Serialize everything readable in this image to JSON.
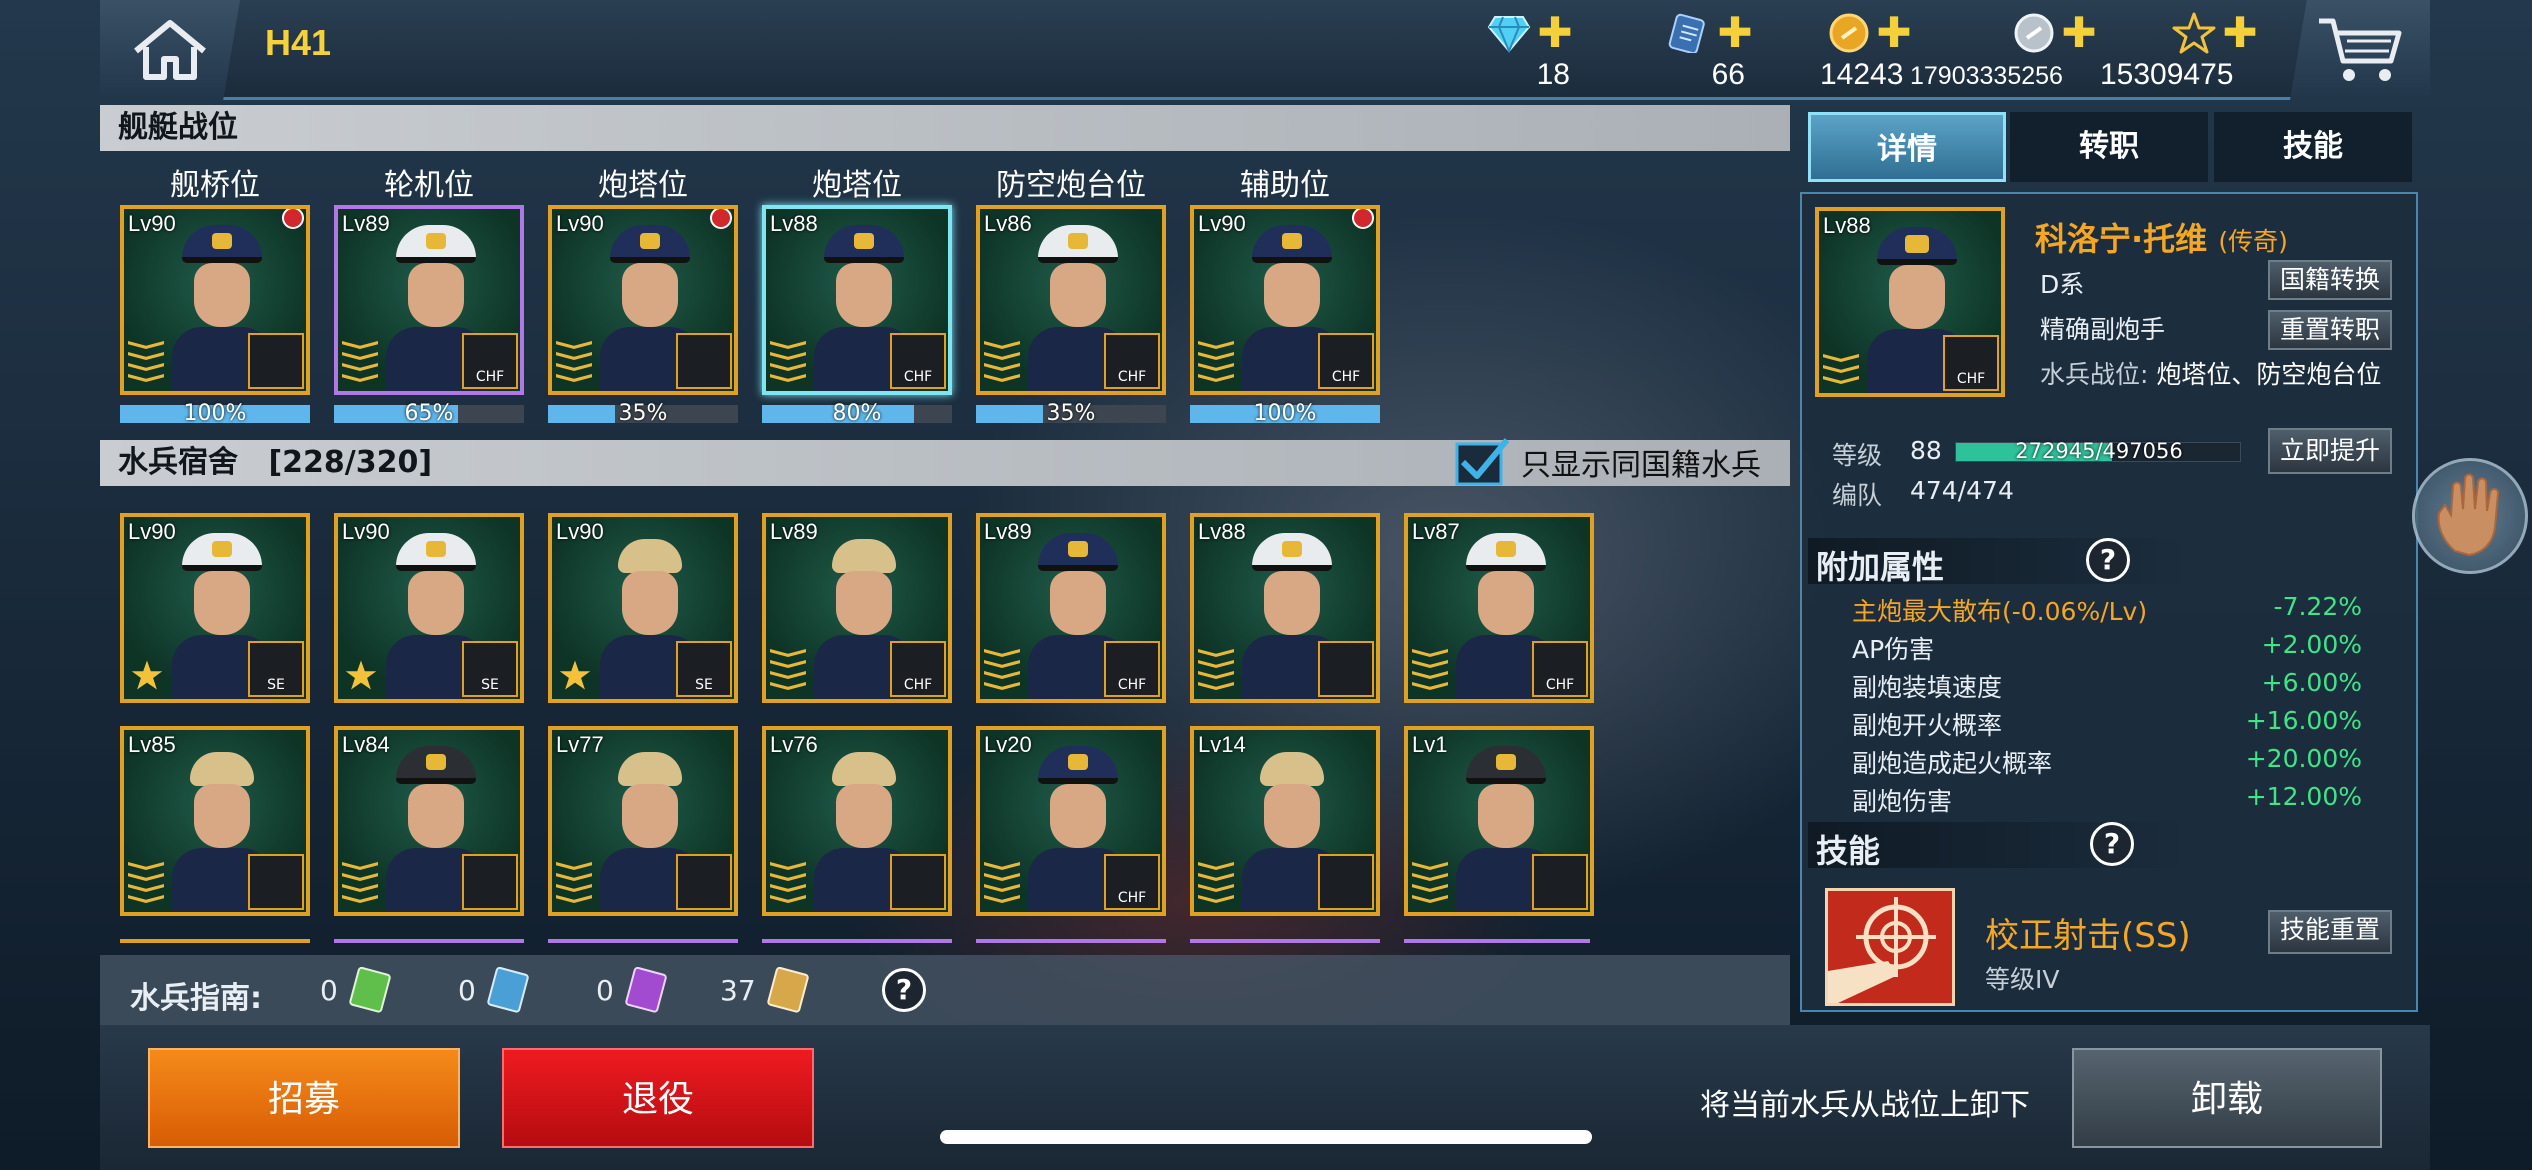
{
  "header": {
    "stage": "H41",
    "resources": [
      {
        "icon": "diamond-icon",
        "value": "18"
      },
      {
        "icon": "ticket-icon",
        "value": "66"
      },
      {
        "icon": "gold-coin-icon",
        "value": "14243"
      },
      {
        "icon": "silver-coin-icon",
        "value": "17903335256"
      },
      {
        "icon": "star-icon",
        "value": "15309475"
      }
    ]
  },
  "ship_positions": {
    "title": "舰艇战位",
    "slots": [
      {
        "label": "舰桥位",
        "lv": "Lv90",
        "percent": "100%",
        "fill": 1.0,
        "red_dot": true,
        "frame": "gold",
        "job_tag": "",
        "job_icon": "radio-icon"
      },
      {
        "label": "轮机位",
        "lv": "Lv89",
        "percent": "65%",
        "fill": 0.65,
        "red_dot": false,
        "frame": "purple",
        "job_tag": "CHF",
        "job_icon": "gear-icon"
      },
      {
        "label": "炮塔位",
        "lv": "Lv90",
        "percent": "35%",
        "fill": 0.35,
        "red_dot": true,
        "frame": "gold",
        "job_tag": "",
        "job_icon": "turret-icon"
      },
      {
        "label": "炮塔位",
        "lv": "Lv88",
        "percent": "80%",
        "fill": 0.8,
        "red_dot": false,
        "frame": "selected",
        "job_tag": "CHF",
        "job_icon": "turret-icon"
      },
      {
        "label": "防空炮台位",
        "lv": "Lv86",
        "percent": "35%",
        "fill": 0.35,
        "red_dot": false,
        "frame": "gold",
        "job_tag": "CHF",
        "job_icon": "aa-gun-icon"
      },
      {
        "label": "辅助位",
        "lv": "Lv90",
        "percent": "100%",
        "fill": 1.0,
        "red_dot": true,
        "frame": "gold",
        "job_tag": "CHF",
        "job_icon": "repair-icon"
      }
    ]
  },
  "barracks": {
    "title": "水兵宿舍",
    "count": "[228/320]",
    "filter_label": "只显示同国籍水兵",
    "filter_checked": true,
    "sailors": [
      {
        "lv": "Lv90",
        "tag": "SE",
        "star": true,
        "hat": "white"
      },
      {
        "lv": "Lv90",
        "tag": "SE",
        "star": true,
        "hat": "white"
      },
      {
        "lv": "Lv90",
        "tag": "SE",
        "star": true,
        "hat": "none"
      },
      {
        "lv": "Lv89",
        "tag": "CHF",
        "star": false,
        "hat": "none"
      },
      {
        "lv": "Lv89",
        "tag": "CHF",
        "star": false,
        "hat": "navy"
      },
      {
        "lv": "Lv88",
        "tag": "",
        "star": false,
        "hat": "white"
      },
      {
        "lv": "Lv87",
        "tag": "CHF",
        "star": false,
        "hat": "white"
      },
      {
        "lv": "Lv85",
        "tag": "",
        "star": false,
        "hat": "none"
      },
      {
        "lv": "Lv84",
        "tag": "",
        "star": false,
        "hat": "dark"
      },
      {
        "lv": "Lv77",
        "tag": "",
        "star": false,
        "hat": "none"
      },
      {
        "lv": "Lv76",
        "tag": "",
        "star": false,
        "hat": "none"
      },
      {
        "lv": "Lv20",
        "tag": "CHF",
        "star": false,
        "hat": "navy"
      },
      {
        "lv": "Lv14",
        "tag": "",
        "star": false,
        "hat": "none"
      },
      {
        "lv": "Lv1",
        "tag": "",
        "star": false,
        "hat": "dark"
      }
    ]
  },
  "guide": {
    "label": "水兵指南:",
    "items": [
      {
        "count": "0",
        "color": "#5fbf4a"
      },
      {
        "count": "0",
        "color": "#4aa0d6"
      },
      {
        "count": "0",
        "color": "#a24ad0"
      },
      {
        "count": "37",
        "color": "#d6a84a"
      }
    ]
  },
  "tabs": [
    "详情",
    "转职",
    "技能"
  ],
  "detail": {
    "portrait_lv": "Lv88",
    "name": "科洛宁·托维",
    "rarity": "(传奇)",
    "faction": "D系",
    "role": "精确副炮手",
    "positions_label": "水兵战位:",
    "positions_value": "炮塔位、防空炮台位",
    "btn_nationality": "国籍转换",
    "btn_reset_job": "重置转职",
    "level_label": "等级",
    "level_value": "88",
    "exp_text": "272945/497056",
    "exp_fill": 0.549,
    "btn_level_up": "立即提升",
    "team_label": "编队",
    "team_value": "474/474",
    "bonus_title": "附加属性",
    "bonus": [
      {
        "name": "主炮最大散布(-0.06%/Lv)",
        "value": "-7.22%",
        "highlight": true
      },
      {
        "name": "AP伤害",
        "value": "+2.00%",
        "highlight": false
      },
      {
        "name": "副炮装填速度",
        "value": "+6.00%",
        "highlight": false
      },
      {
        "name": "副炮开火概率",
        "value": "+16.00%",
        "highlight": false
      },
      {
        "name": "副炮造成起火概率",
        "value": "+20.00%",
        "highlight": false
      },
      {
        "name": "副炮伤害",
        "value": "+12.00%",
        "highlight": false
      }
    ],
    "skill_title": "技能",
    "skill_name": "校正射击(SS)",
    "skill_level": "等级IV",
    "btn_skill_reset": "技能重置"
  },
  "footer": {
    "recruit": "招募",
    "retire": "退役",
    "hint": "将当前水兵从战位上卸下",
    "unload": "卸载"
  },
  "colors": {
    "gold": "#e1a021",
    "purple": "#b277e6",
    "highlight_cyan": "#7ee6f2",
    "accent_yellow": "#f6d23a",
    "green_value": "#3ee486",
    "orange_name": "#f5a623",
    "recruit_orange": "#f07a10",
    "retire_red": "#d9151a"
  }
}
